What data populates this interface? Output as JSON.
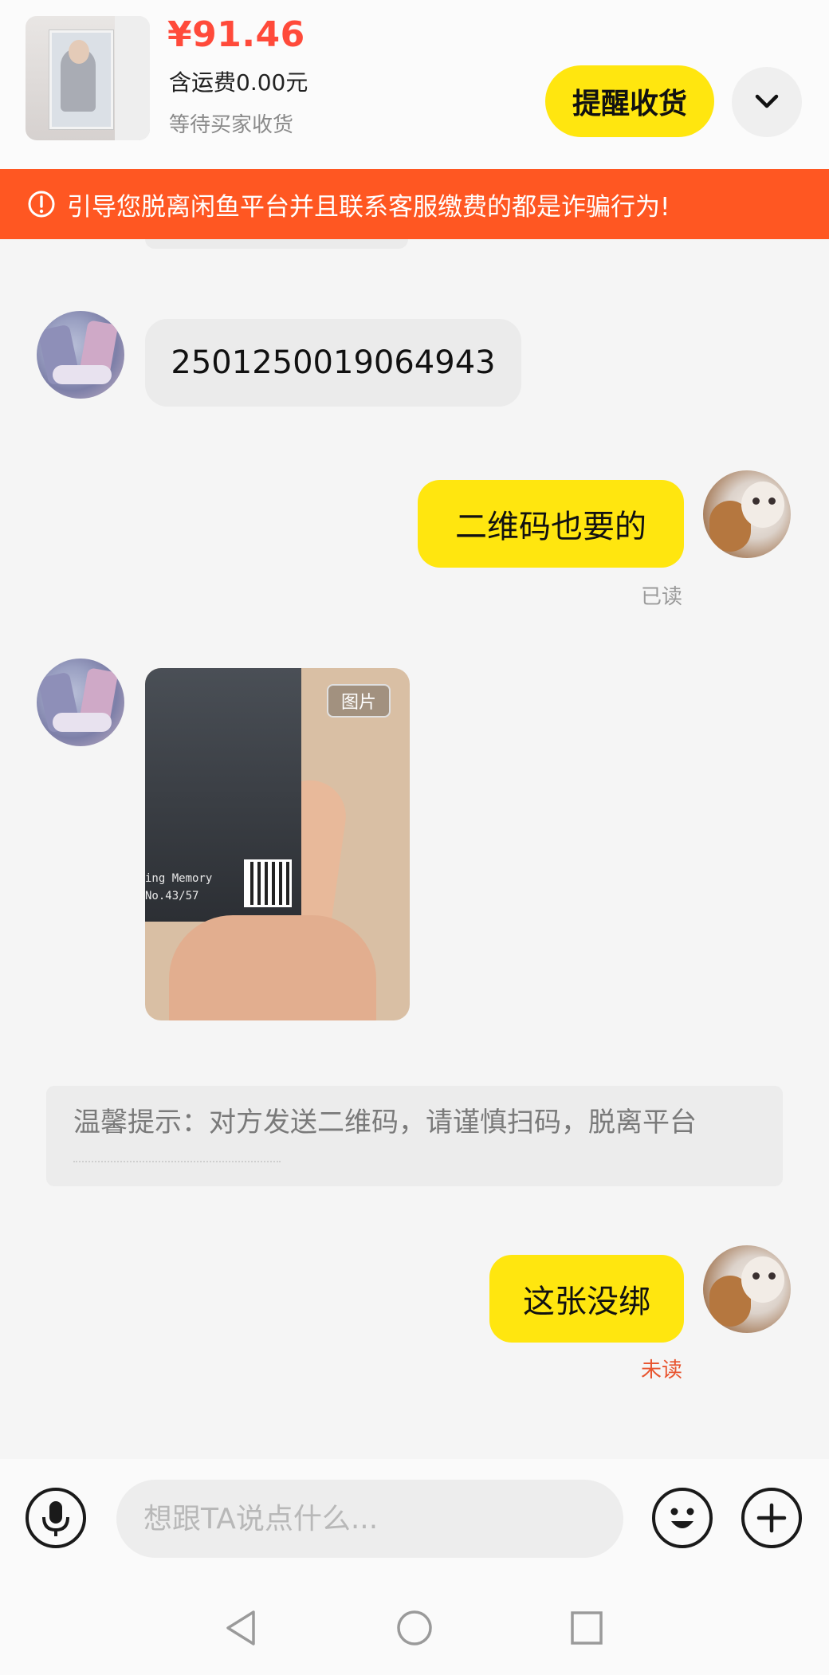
{
  "order": {
    "price": "¥91.46",
    "shipping": "含运费0.00元",
    "status": "等待买家收货",
    "remind_button": "提醒收货",
    "more_icon": "chevron-down-icon"
  },
  "warning": {
    "icon": "alert-circle-icon",
    "text": "引导您脱离闲鱼平台并且联系客服缴费的都是诈骗行为!"
  },
  "messages": [
    {
      "from": "them",
      "type": "text",
      "text": "2501250019064943"
    },
    {
      "from": "me",
      "type": "text",
      "text": "二维码也要的",
      "read_status": "已读"
    },
    {
      "from": "them",
      "type": "image",
      "tag": "图片",
      "card_line1": "ing Memory",
      "card_line2": "No.43/57"
    },
    {
      "type": "tip",
      "text": "温馨提示：对方发送二维码，请谨慎扫码，脱离平台"
    },
    {
      "from": "me",
      "type": "text",
      "text": "这张没绑",
      "read_status": "未读"
    }
  ],
  "input": {
    "placeholder": "想跟TA说点什么...",
    "voice_icon": "microphone-icon",
    "emoji_icon": "emoji-icon",
    "plus_icon": "plus-icon"
  },
  "system_nav": [
    "back-icon",
    "home-icon",
    "recents-icon"
  ],
  "colors": {
    "accent_yellow": "#ffe60f",
    "price_red": "#ff4a3a",
    "warning_orange": "#ff5722",
    "unread_red": "#e8542e",
    "read_gray": "#9a9a9a"
  }
}
